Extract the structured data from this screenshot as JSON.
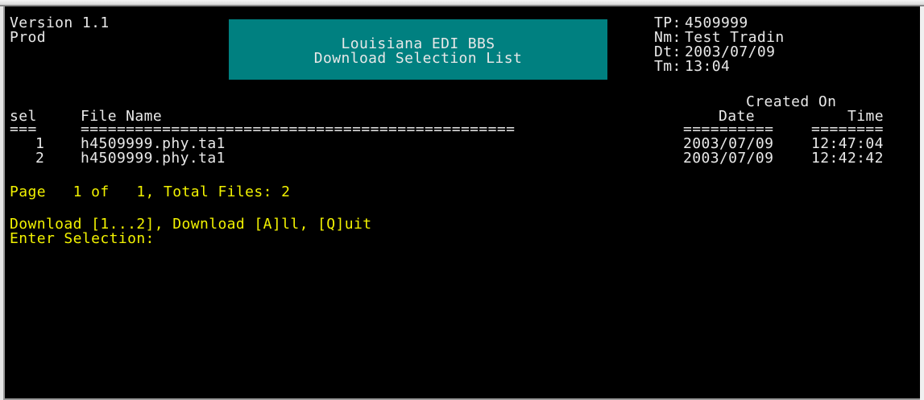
{
  "header": {
    "version": "Version 1.1",
    "environment": "Prod",
    "title_line1": "Louisiana EDI BBS",
    "title_line2": "Download Selection List",
    "info": [
      {
        "label": "TP:",
        "value": "4509999"
      },
      {
        "label": "Nm:",
        "value": "Test Tradin"
      },
      {
        "label": "Dt:",
        "value": "2003/07/09"
      },
      {
        "label": "Tm:",
        "value": "13:04"
      }
    ]
  },
  "table": {
    "created_on_label": "Created On",
    "col_sel": "sel",
    "col_file_name": "File Name",
    "col_date": "Date",
    "col_time": "Time",
    "sep_sel": "===",
    "sep_file": "================================================",
    "sep_date": "==========",
    "sep_time": "========",
    "rows": [
      {
        "sel": "1",
        "file": "h4509999.phy.ta1",
        "date": "2003/07/09",
        "time": "12:47:04"
      },
      {
        "sel": "2",
        "file": "h4509999.phy.ta1",
        "date": "2003/07/09",
        "time": "12:42:42"
      }
    ]
  },
  "footer": {
    "page_line": "Page   1 of   1, Total Files: 2",
    "options_line": "Download [1...2], Download [A]ll, [Q]uit",
    "prompt": "Enter Selection:"
  },
  "colors": {
    "background": "#000000",
    "text": "#e8e8e8",
    "prompt_text": "#f2f200",
    "title_box": "#008080"
  }
}
